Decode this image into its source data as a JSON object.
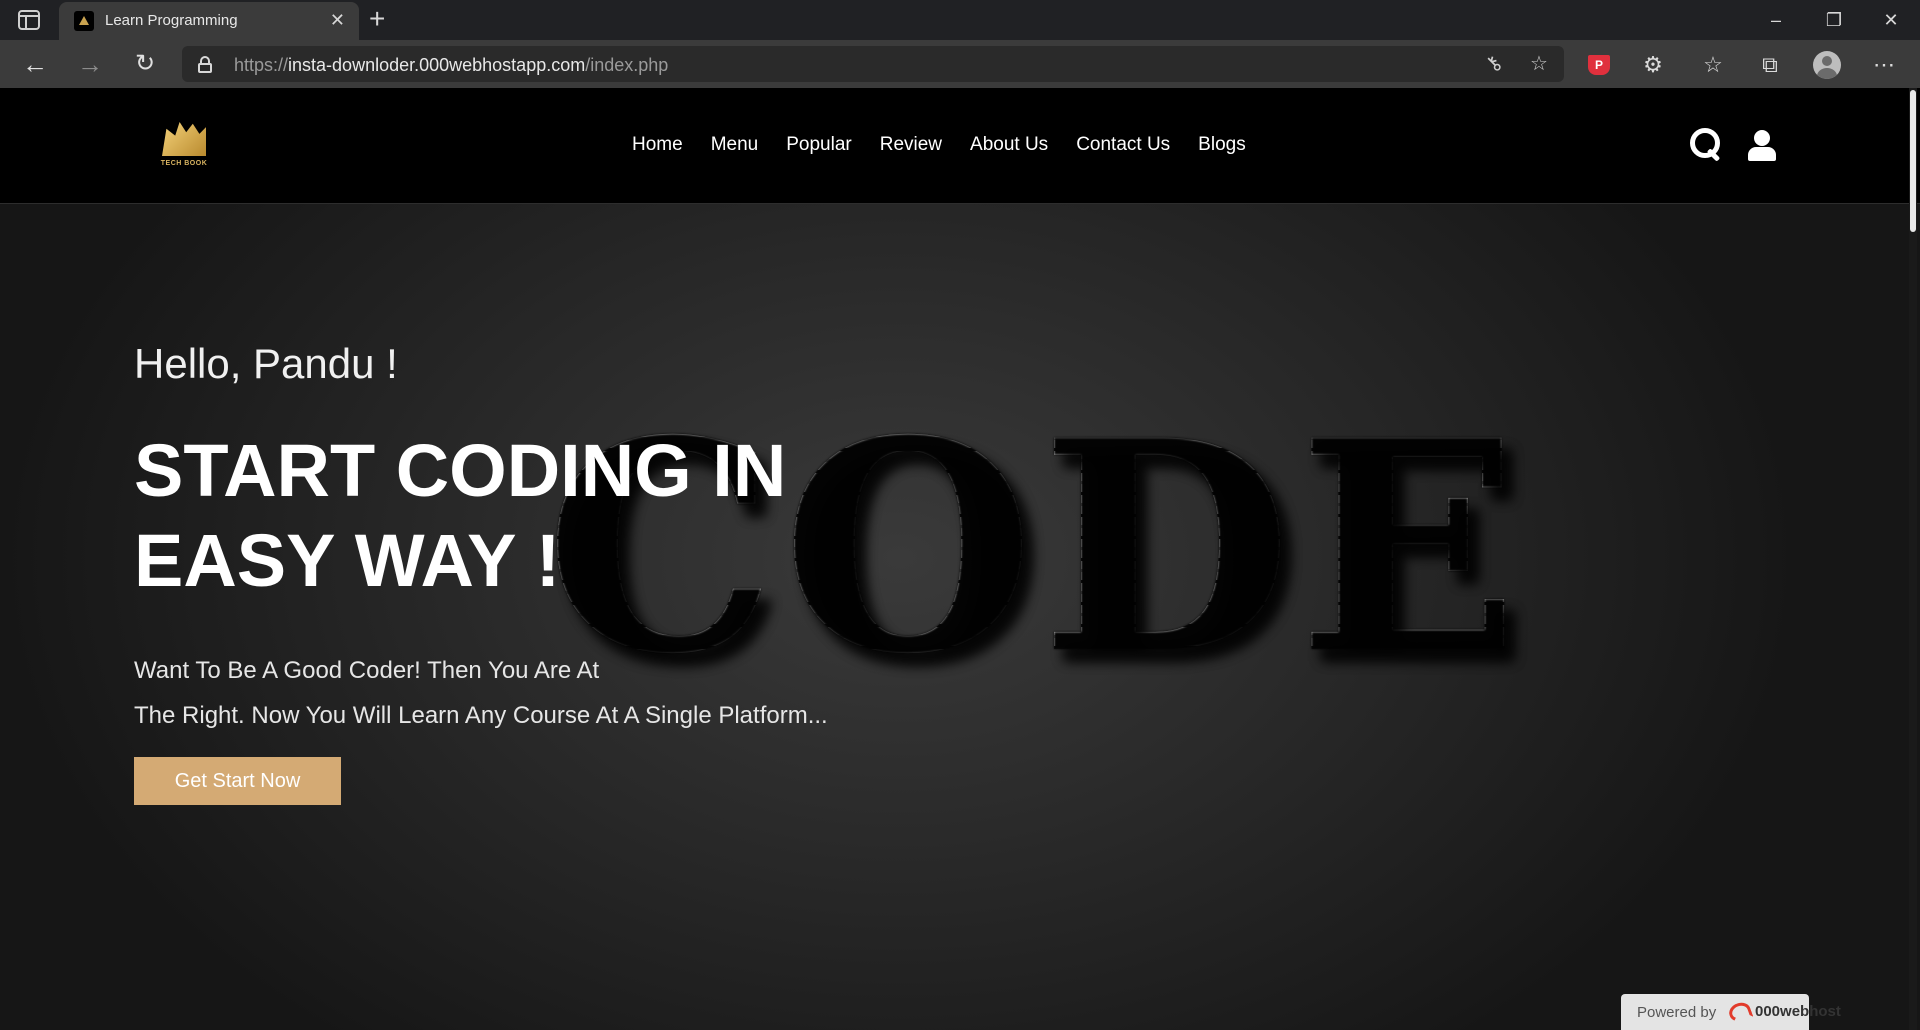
{
  "browser": {
    "tab_title": "Learn Programming",
    "tab_close_glyph": "✕",
    "new_tab_glyph": "+",
    "url_scheme": "https://",
    "url_host": "insta-downloder.000webhostapp.com",
    "url_path": "/index.php",
    "window_controls": {
      "minimize": "–",
      "maximize": "❐",
      "close": "✕"
    },
    "nav_glyphs": {
      "back": "←",
      "forward": "→",
      "reload": "↻"
    },
    "toolbar_glyphs": {
      "key": "⚷",
      "add_favorite": "☆",
      "extensions": "⚙",
      "favorites": "☆",
      "collections": "⧉",
      "more": "⋯",
      "pocket": "P"
    }
  },
  "site": {
    "logo_text": "TECH BOOK",
    "menu": [
      "Home",
      "Menu",
      "Popular",
      "Review",
      "About Us",
      "Contact Us",
      "Blogs"
    ],
    "hero": {
      "greeting": "Hello, Pandu !",
      "headline_line1": "START CODING IN",
      "headline_line2": "EASY WAY !",
      "sub_line1": "Want To Be A Good Coder! Then You Are At",
      "sub_line2": "The Right. Now You Will Learn Any Course At A Single Platform...",
      "cta": "Get Start Now",
      "background_word": "CODE"
    },
    "powered_by": {
      "label": "Powered by",
      "brand": "000webhost"
    }
  },
  "colors": {
    "accent": "#d4aa74",
    "navbar": "#000000",
    "chrome": "#3b3b3b"
  }
}
